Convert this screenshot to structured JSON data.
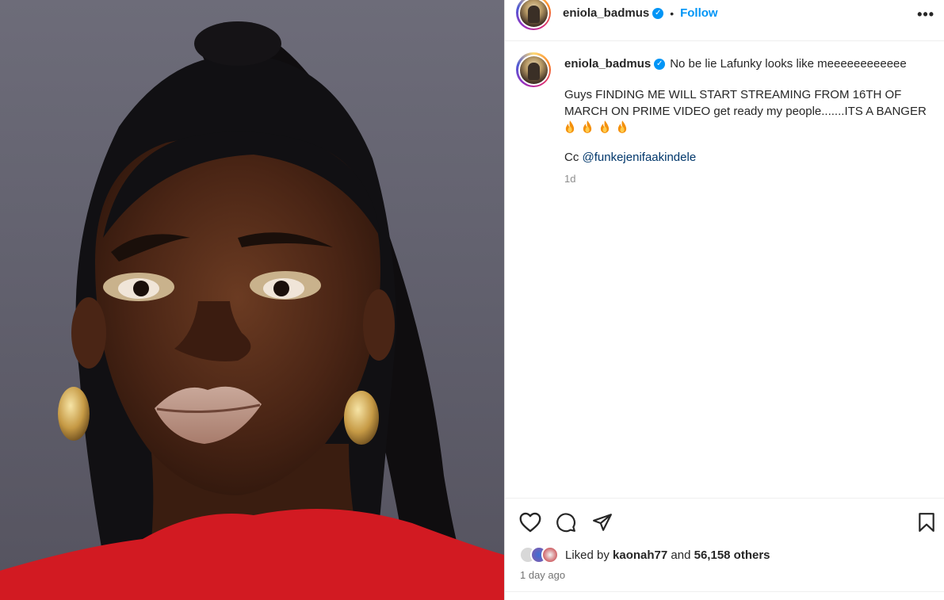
{
  "header": {
    "username": "eniola_badmus",
    "separator": "•",
    "follow_label": "Follow",
    "more_label": "•••"
  },
  "caption": {
    "username": "eniola_badmus",
    "line1": "No be lie Lafunky looks like meeeeeeeeeeee",
    "paragraph": "Guys FINDING ME WILL START STREAMING FROM 16TH OF MARCH ON PRIME VIDEO get ready my people.......ITS A BANGER",
    "emojis": [
      "fire",
      "fire",
      "fire",
      "fire"
    ],
    "cc_prefix": "Cc ",
    "mention": "@funkejenifaakindele",
    "relative_time": "1d"
  },
  "actions": {
    "icons": [
      "heart-icon",
      "comment-icon",
      "share-icon",
      "bookmark-icon"
    ],
    "liked_by_prefix": "Liked by ",
    "liked_by_user": "kaonah77",
    "liked_by_and": " and ",
    "liked_by_count": "56,158 others",
    "post_time": "1 day ago"
  },
  "colors": {
    "follow": "#0095f6",
    "verified": "#0095f6",
    "mention": "#00376b",
    "photo_background": "#64636f",
    "shirt": "#d21a22"
  }
}
